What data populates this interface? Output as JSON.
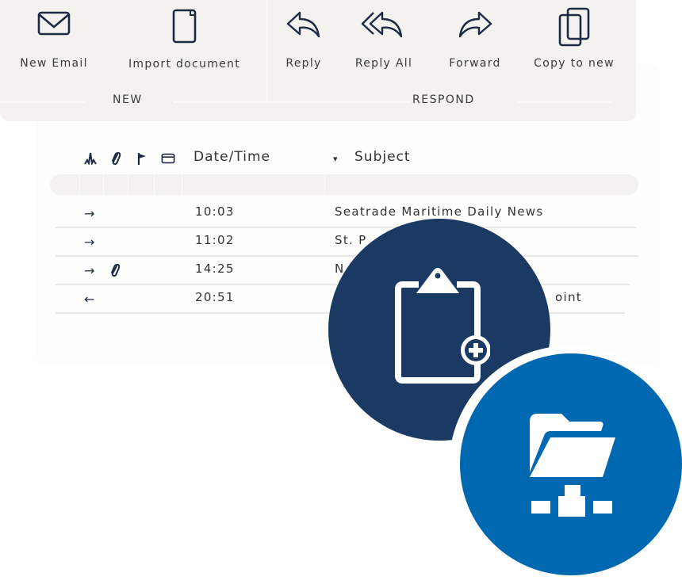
{
  "toolbar": {
    "groups": [
      {
        "label": "NEW",
        "buttons": [
          {
            "label": "New Email",
            "icon": "envelope-icon"
          },
          {
            "label": "Import document",
            "icon": "document-icon"
          }
        ]
      },
      {
        "label": "RESPOND",
        "buttons": [
          {
            "label": "Reply",
            "icon": "reply-icon"
          },
          {
            "label": "Reply All",
            "icon": "reply-all-icon"
          },
          {
            "label": "Forward",
            "icon": "forward-icon"
          },
          {
            "label": "Copy to new",
            "icon": "copy-icon"
          }
        ]
      }
    ]
  },
  "mail_list": {
    "header_icons": [
      "status-icon",
      "attachment-icon",
      "flag-icon",
      "folder-icon"
    ],
    "columns": {
      "datetime": "Date/Time",
      "subject": "Subject",
      "sort_indicator": "▾"
    },
    "rows": [
      {
        "direction": "→",
        "direction_icon": "incoming-arrow-icon",
        "attachment": false,
        "time": "10:03",
        "subject": "Seatrade Maritime Daily News"
      },
      {
        "direction": "→",
        "direction_icon": "incoming-arrow-icon",
        "attachment": false,
        "time": "11:02",
        "subject": "St. P"
      },
      {
        "direction": "→",
        "direction_icon": "incoming-arrow-icon",
        "attachment": true,
        "time": "14:25",
        "subject": "N"
      },
      {
        "direction": "←",
        "direction_icon": "outgoing-arrow-icon",
        "attachment": false,
        "time": "20:51",
        "subject": "oint"
      }
    ]
  },
  "badges": [
    {
      "name": "clipboard-add",
      "icon": "clipboard-plus-icon",
      "color": "#1b3a63"
    },
    {
      "name": "network-folder",
      "icon": "network-folder-icon",
      "color": "#0068b0"
    }
  ],
  "colors": {
    "toolbar_bg": "#f3f2ef",
    "icon_stroke": "#1e2a44",
    "text": "#333333"
  }
}
